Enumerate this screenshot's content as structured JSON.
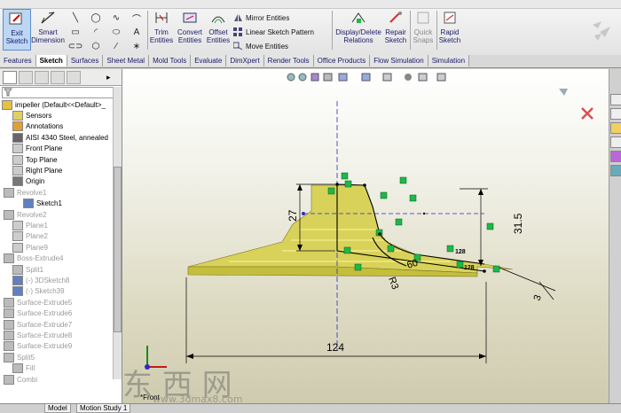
{
  "command_manager": {
    "exit_sketch": "Exit\nSketch",
    "smart_dimension": "Smart\nDimension",
    "trim_entities": "Trim\nEntities",
    "convert_entities": "Convert\nEntities",
    "offset_entities": "Offset\nEntities",
    "mirror_entities": "Mirror Entities",
    "linear_sketch_pattern": "Linear Sketch Pattern",
    "move_entities": "Move Entities",
    "display_delete_relations": "Display/Delete\nRelations",
    "repair_sketch": "Repair\nSketch",
    "quick_snaps": "Quick\nSnaps",
    "rapid_sketch": "Rapid\nSketch"
  },
  "tabs": [
    "Features",
    "Sketch",
    "Surfaces",
    "Sheet Metal",
    "Mold Tools",
    "Evaluate",
    "DimXpert",
    "Render Tools",
    "Office Products",
    "Flow Simulation",
    "Simulation"
  ],
  "active_tab": "Sketch",
  "feature_tree": [
    {
      "label": "impeller  (Default<<Default>_",
      "dim": false,
      "indent": 2,
      "icon": "part-icon"
    },
    {
      "label": "Sensors",
      "dim": false,
      "indent": 14,
      "icon": "sensor-icon"
    },
    {
      "label": "Annotations",
      "dim": false,
      "indent": 14,
      "icon": "annotation-icon"
    },
    {
      "label": "AISI 4340 Steel, annealed",
      "dim": false,
      "indent": 14,
      "icon": "material-icon"
    },
    {
      "label": "Front Plane",
      "dim": false,
      "indent": 14,
      "icon": "plane-icon"
    },
    {
      "label": "Top Plane",
      "dim": false,
      "indent": 14,
      "icon": "plane-icon"
    },
    {
      "label": "Right Plane",
      "dim": false,
      "indent": 14,
      "icon": "plane-icon"
    },
    {
      "label": "Origin",
      "dim": false,
      "indent": 14,
      "icon": "origin-icon"
    },
    {
      "label": "Revolve1",
      "dim": true,
      "indent": 4,
      "icon": "revolve-icon"
    },
    {
      "label": "Sketch1",
      "dim": false,
      "indent": 26,
      "icon": "sketch-icon"
    },
    {
      "label": "Revolve2",
      "dim": true,
      "indent": 4,
      "icon": "revolve-icon"
    },
    {
      "label": "Plane1",
      "dim": true,
      "indent": 14,
      "icon": "plane-icon"
    },
    {
      "label": "Plane2",
      "dim": true,
      "indent": 14,
      "icon": "plane-icon"
    },
    {
      "label": "Plane9",
      "dim": true,
      "indent": 14,
      "icon": "plane-icon"
    },
    {
      "label": "Boss-Extrude4",
      "dim": true,
      "indent": 4,
      "icon": "extrude-icon"
    },
    {
      "label": "Split1",
      "dim": true,
      "indent": 14,
      "icon": "split-icon"
    },
    {
      "label": "(-) 3DSketch8",
      "dim": true,
      "indent": 14,
      "icon": "sketch-icon"
    },
    {
      "label": "(-) Sketch39",
      "dim": true,
      "indent": 14,
      "icon": "sketch-icon"
    },
    {
      "label": "Surface-Extrude5",
      "dim": true,
      "indent": 4,
      "icon": "surface-icon"
    },
    {
      "label": "Surface-Extrude6",
      "dim": true,
      "indent": 4,
      "icon": "surface-icon"
    },
    {
      "label": "Surface-Extrude7",
      "dim": true,
      "indent": 4,
      "icon": "surface-icon"
    },
    {
      "label": "Surface-Extrude8",
      "dim": true,
      "indent": 4,
      "icon": "surface-icon"
    },
    {
      "label": "Surface-Extrude9",
      "dim": true,
      "indent": 4,
      "icon": "surface-icon"
    },
    {
      "label": "Split5",
      "dim": true,
      "indent": 4,
      "icon": "split-icon"
    },
    {
      "label": "Fill",
      "dim": true,
      "indent": 14,
      "icon": "surface-icon"
    },
    {
      "label": "Combi",
      "dim": true,
      "indent": 4,
      "icon": "combine-icon"
    }
  ],
  "dimensions": {
    "width": "124",
    "height_left": "27",
    "height_right": "31.5",
    "angle": "60",
    "radius": "R3",
    "small": "3",
    "note_a": "128",
    "note_b": "128"
  },
  "view_label": "*Front",
  "bottom_tabs": [
    "Model",
    "Motion Study 1"
  ],
  "watermark": "东 西 网",
  "watermark_url": "www.3dmax8.com",
  "colors": {
    "sketch_line": "#000000",
    "relation_green": "#1db848",
    "construction_blue": "#2a2acc",
    "part_yellow": "#d8d25a"
  }
}
